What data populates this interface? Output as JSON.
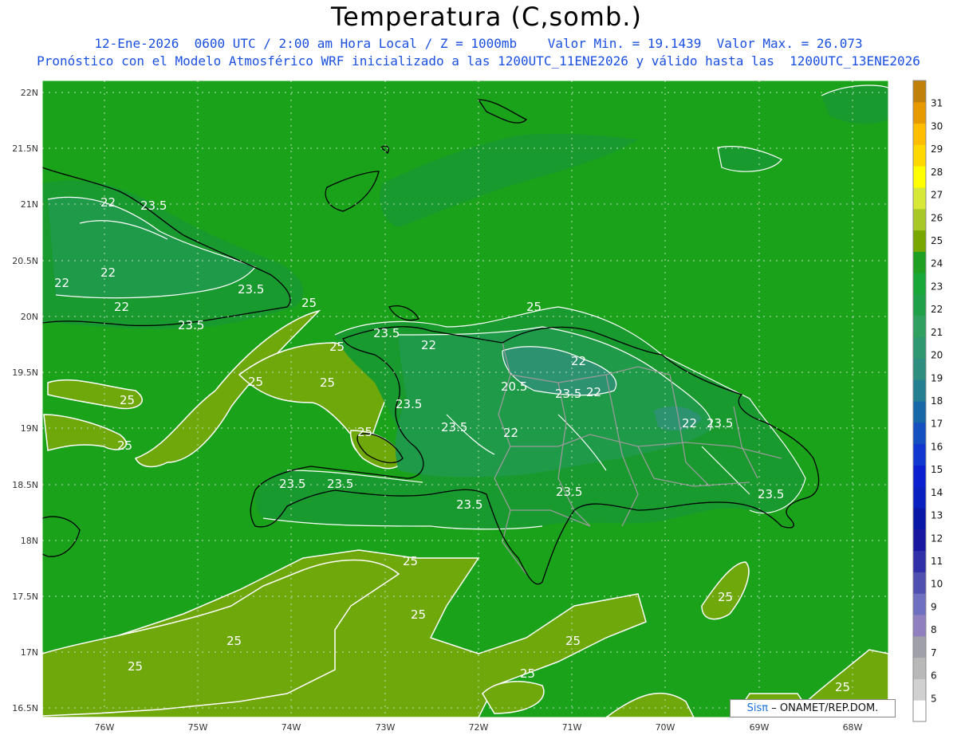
{
  "header": {
    "title": "Temperatura (C,somb.)",
    "line1": "12-Ene-2026  0600 UTC / 2:00 am Hora Local / Z = 1000mb    Valor Min. = 19.1439  Valor Max. = 26.073",
    "line2": "Pronóstico con el Modelo Atmosférico WRF inicializado a las 1200UTC_11ENE2026 y válido hasta las  1200UTC_13ENE2026"
  },
  "axes": {
    "lat_labels": [
      "22N",
      "21.5N",
      "21N",
      "20.5N",
      "20N",
      "19.5N",
      "19N",
      "18.5N",
      "18N",
      "17.5N",
      "17N",
      "16.5N"
    ],
    "lon_labels": [
      "76W",
      "75W",
      "74W",
      "73W",
      "72W",
      "71W",
      "70W",
      "69W",
      "68W"
    ]
  },
  "contour_labels": [
    "22",
    "23.5",
    "22",
    "22",
    "23.5",
    "22",
    "23.5",
    "25",
    "23.5",
    "22",
    "22",
    "20.5",
    "23.5",
    "22",
    "22",
    "23.5",
    "23.5",
    "23.5",
    "22",
    "23.5",
    "23.5",
    "23.5",
    "23.5",
    "23.5",
    "25",
    "25",
    "25",
    "25",
    "25",
    "25",
    "25",
    "25",
    "25",
    "25",
    "25",
    "25",
    "25",
    "25",
    "25"
  ],
  "colorbar": {
    "labels": [
      "31",
      "30",
      "29",
      "28",
      "27",
      "26",
      "25",
      "24",
      "23",
      "22",
      "21",
      "20",
      "19",
      "18",
      "17",
      "16",
      "15",
      "14",
      "13",
      "12",
      "11",
      "10",
      "9",
      "8",
      "7",
      "6",
      "5"
    ],
    "colors": [
      "#c0800a",
      "#e69a00",
      "#ffbf00",
      "#ffd800",
      "#ffff00",
      "#d8e838",
      "#a8c828",
      "#78a800",
      "#20a020",
      "#18a838",
      "#20a048",
      "#30a060",
      "#2e9870",
      "#2e8f80",
      "#248090",
      "#1868a8",
      "#1450c0",
      "#1038d0",
      "#0a20d0",
      "#0820c0",
      "#0a18a8",
      "#1818a0",
      "#3030a8",
      "#5050b0",
      "#7070c0",
      "#9080c0",
      "#a0a0a8",
      "#b8b8b8",
      "#d0d0d0",
      "#ffffff"
    ]
  },
  "credit": {
    "brand": "Sisπ",
    "text": "– ONAMET/REP.DOM."
  }
}
